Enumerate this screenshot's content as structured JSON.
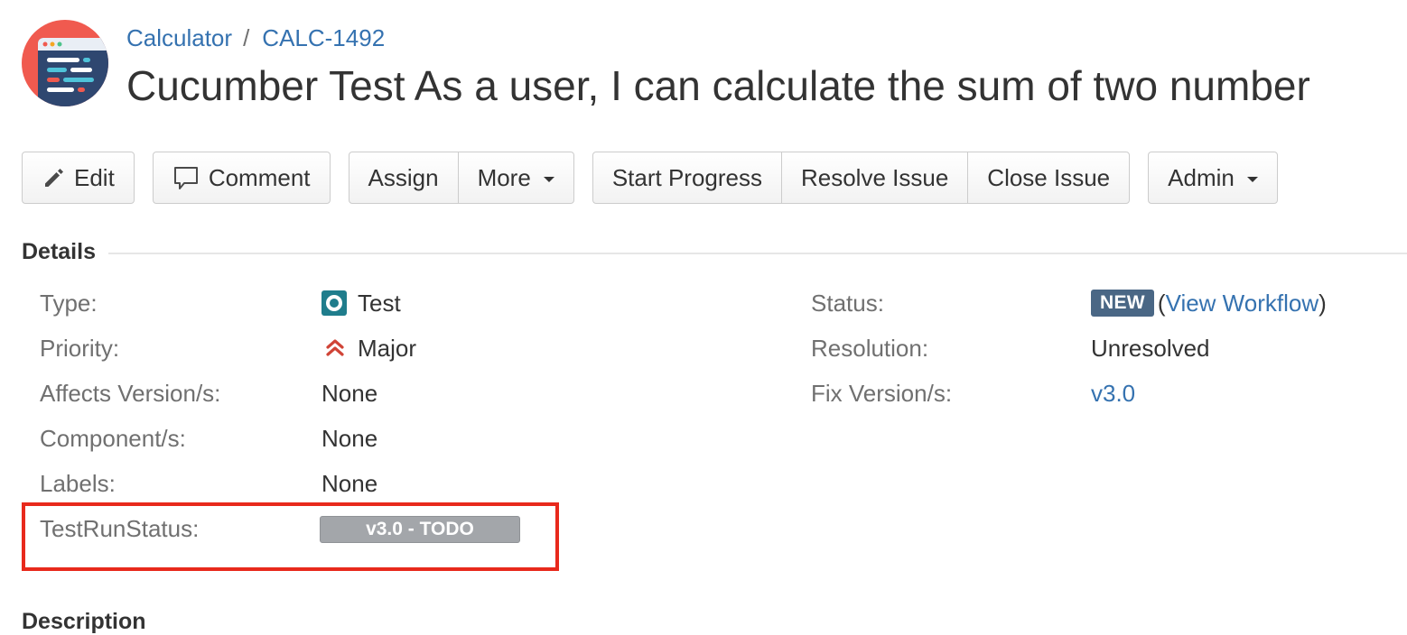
{
  "breadcrumb": {
    "project": "Calculator",
    "separator": "/",
    "issue_key": "CALC-1492"
  },
  "issue": {
    "title": "Cucumber Test As a user, I can calculate the sum of two number"
  },
  "toolbar": {
    "edit_label": "Edit",
    "comment_label": "Comment",
    "assign_label": "Assign",
    "more_label": "More",
    "start_progress_label": "Start Progress",
    "resolve_issue_label": "Resolve Issue",
    "close_issue_label": "Close Issue",
    "admin_label": "Admin"
  },
  "details": {
    "heading": "Details",
    "left_fields": [
      {
        "label": "Type:",
        "value": "Test",
        "icon": "test-type-icon"
      },
      {
        "label": "Priority:",
        "value": "Major",
        "icon": "priority-major-icon"
      },
      {
        "label": "Affects Version/s:",
        "value": "None"
      },
      {
        "label": "Component/s:",
        "value": "None"
      },
      {
        "label": "Labels:",
        "value": "None"
      },
      {
        "label": "TestRunStatus:",
        "value": "v3.0 - TODO"
      }
    ],
    "right_fields": [
      {
        "label": "Status:",
        "value": "NEW",
        "link": "View Workflow"
      },
      {
        "label": "Resolution:",
        "value": "Unresolved"
      },
      {
        "label": "Fix Version/s:",
        "value": "v3.0"
      }
    ]
  },
  "description": {
    "heading": "Description"
  },
  "colors": {
    "link": "#3572b0",
    "status_new": "#4a6785",
    "highlight": "#e8291c",
    "badge_gray": "#a3a6aa",
    "priority_major": "#d04437",
    "type_test": "#1f7d8c",
    "avatar_bg": "#f05a4f"
  }
}
